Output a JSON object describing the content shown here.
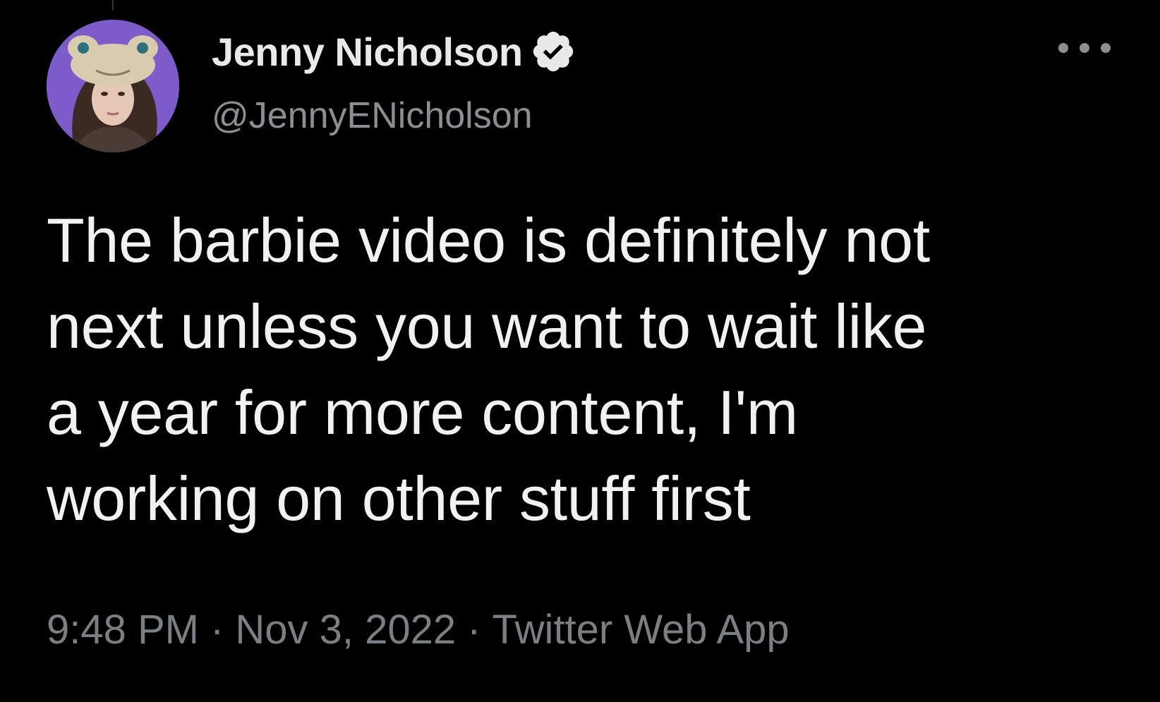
{
  "author": {
    "display_name": "Jenny Nicholson",
    "handle": "@JennyENicholson",
    "verified": true,
    "avatar_icon": "profile-photo"
  },
  "tweet": {
    "text_lines": [
      "The barbie video is definitely not",
      "next unless you want to wait like",
      "a year for more content, I'm",
      "working on other stuff first"
    ]
  },
  "meta": {
    "time": "9:48 PM",
    "separator": "·",
    "date": "Nov 3, 2022",
    "source": "Twitter Web App"
  },
  "icons": {
    "more": "more-dots-icon",
    "verified": "verified-badge-icon"
  },
  "colors": {
    "background": "#000000",
    "primary_text": "#e7e9ea",
    "secondary_text": "#8b8f94",
    "avatar_bg": "#7d5cc9"
  }
}
